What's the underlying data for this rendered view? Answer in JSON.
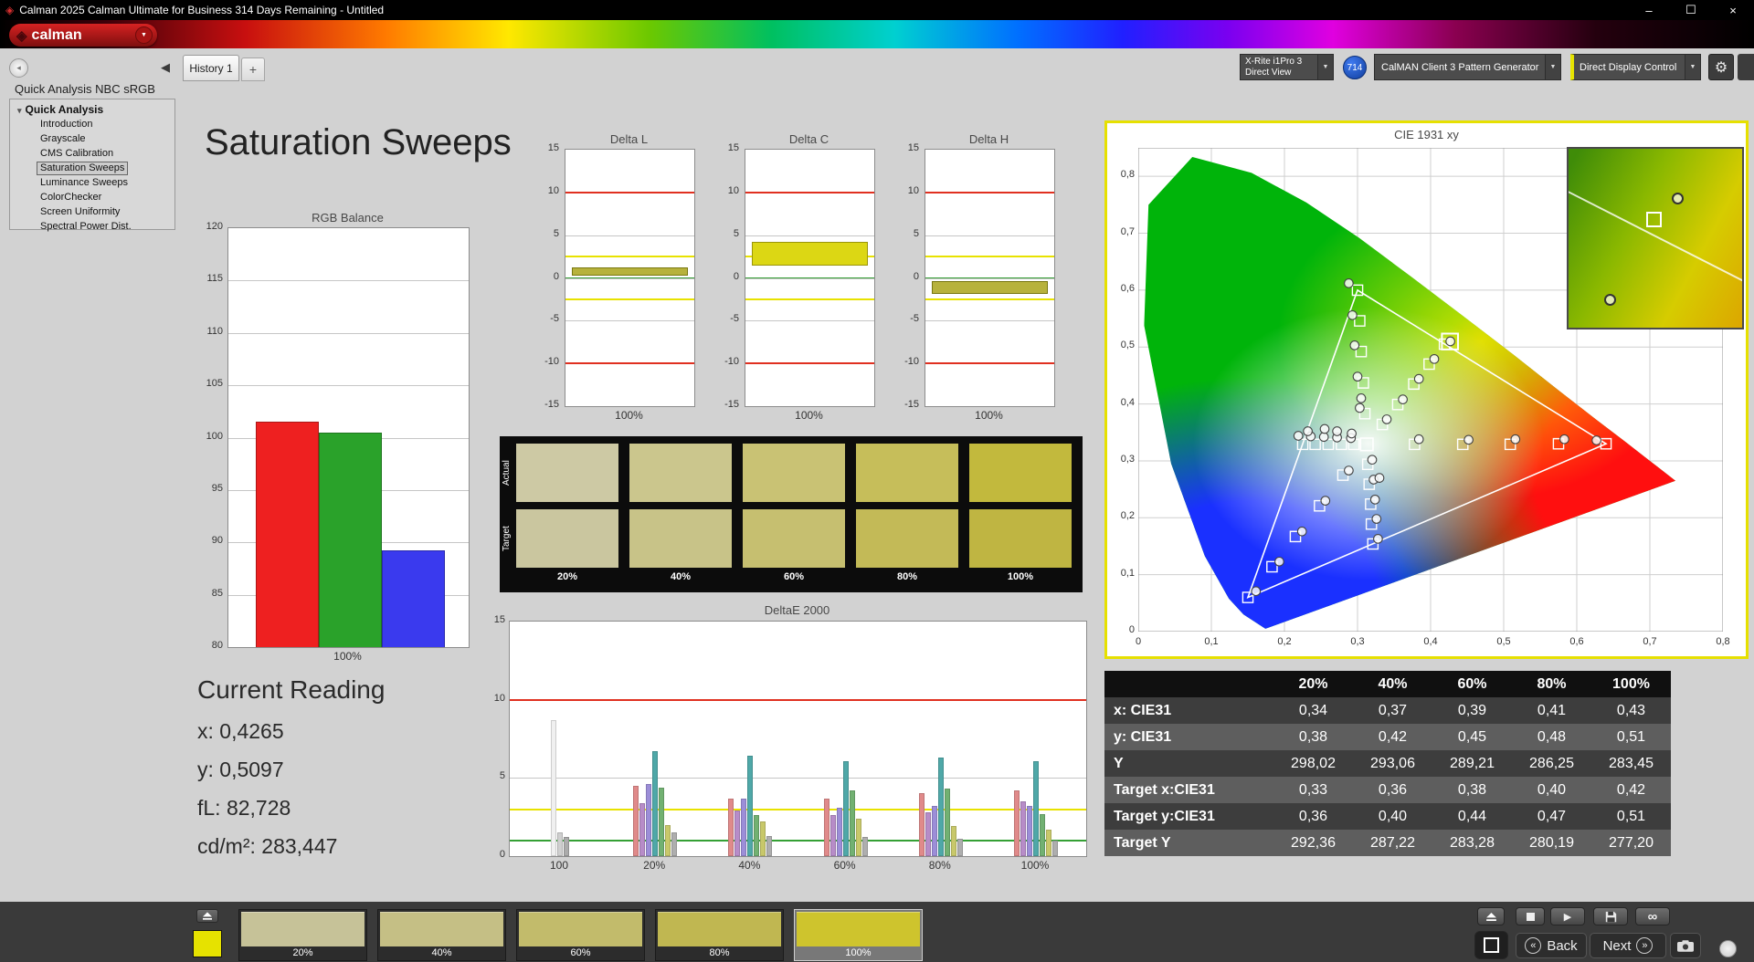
{
  "window": {
    "title": "Calman 2025 Calman Ultimate for Business 314 Days Remaining  - Untitled",
    "minimize_glyph": "–",
    "maximize_glyph": "☐",
    "close_glyph": "×"
  },
  "brand": {
    "logo_text": "calman"
  },
  "icons": {
    "app_diamond": "◈",
    "dropdown": "▼",
    "tree_expander": "▾",
    "collapse_left": "◀",
    "nav_circle": "◂",
    "gear": "⚙",
    "play": "▶",
    "infinity": "∞",
    "back_chevrons": "«",
    "next_chevrons": "»",
    "plus": "+"
  },
  "tabs": {
    "history_label": "History 1",
    "add_label": "+"
  },
  "toolbar": {
    "meter_line1": "X-Rite i1Pro 3",
    "meter_line2": "Direct View",
    "meter_count": "714",
    "pattern_generator": "CalMAN Client 3 Pattern Generator",
    "display_control": "Direct Display Control"
  },
  "sidebar": {
    "workflow_label": "Quick Analysis NBC sRGB",
    "root_label": "Quick Analysis",
    "items": [
      {
        "label": "Introduction",
        "selected": false
      },
      {
        "label": "Grayscale",
        "selected": false
      },
      {
        "label": "CMS Calibration",
        "selected": false
      },
      {
        "label": "Saturation Sweeps",
        "selected": true
      },
      {
        "label": "Luminance Sweeps",
        "selected": false
      },
      {
        "label": "ColorChecker",
        "selected": false
      },
      {
        "label": "Screen Uniformity",
        "selected": false
      },
      {
        "label": "Spectral Power Dist.",
        "selected": false
      }
    ]
  },
  "page": {
    "title": "Saturation Sweeps"
  },
  "current_reading": {
    "title": "Current Reading",
    "x": "x: 0,4265",
    "y": "y: 0,5097",
    "fl": "fL: 82,728",
    "cdm2": "cd/m²: 283,447"
  },
  "chart_data": [
    {
      "id": "rgb_balance",
      "type": "bar",
      "title": "RGB Balance",
      "categories": [
        "Red",
        "Green",
        "Blue"
      ],
      "values": [
        101.5,
        100.5,
        89.2
      ],
      "colors": [
        "#ee2020",
        "#2aa22a",
        "#3a3aee"
      ],
      "xlabel": "100%",
      "ylim": [
        80,
        120
      ],
      "yticks": [
        80,
        85,
        90,
        95,
        100,
        105,
        110,
        115,
        120
      ]
    },
    {
      "id": "delta_l",
      "type": "span-bar",
      "title": "Delta L",
      "ylim": [
        -15,
        15
      ],
      "yticks": [
        15,
        10,
        5,
        0,
        -5,
        -10,
        -15
      ],
      "xlabel": "100%",
      "span": {
        "from": 0.3,
        "to": 1.2
      },
      "bar_color": "#b7b23c",
      "bar_border": "#77770e",
      "ref_lines": [
        {
          "y": 10,
          "color": "#e03020"
        },
        {
          "y": -10,
          "color": "#e03020"
        },
        {
          "y": 2.5,
          "color": "#e8e200"
        },
        {
          "y": -2.5,
          "color": "#e8e200"
        },
        {
          "y": 0,
          "color": "#35a035"
        }
      ]
    },
    {
      "id": "delta_c",
      "type": "span-bar",
      "title": "Delta C",
      "ylim": [
        -15,
        15
      ],
      "yticks": [
        15,
        10,
        5,
        0,
        -5,
        -10,
        -15
      ],
      "xlabel": "100%",
      "span": {
        "from": 1.4,
        "to": 4.2
      },
      "bar_color": "#dcd714",
      "bar_border": "#99950a",
      "ref_lines": [
        {
          "y": 10,
          "color": "#e03020"
        },
        {
          "y": -10,
          "color": "#e03020"
        },
        {
          "y": 2.5,
          "color": "#e8e200"
        },
        {
          "y": -2.5,
          "color": "#e8e200"
        },
        {
          "y": 0,
          "color": "#35a035"
        }
      ]
    },
    {
      "id": "delta_h",
      "type": "span-bar",
      "title": "Delta H",
      "ylim": [
        -15,
        15
      ],
      "yticks": [
        15,
        10,
        5,
        0,
        -5,
        -10,
        -15
      ],
      "xlabel": "100%",
      "span": {
        "from": -1.9,
        "to": -0.4
      },
      "bar_color": "#b7b23c",
      "bar_border": "#77770e",
      "ref_lines": [
        {
          "y": 10,
          "color": "#e03020"
        },
        {
          "y": -10,
          "color": "#e03020"
        },
        {
          "y": 2.5,
          "color": "#e8e200"
        },
        {
          "y": -2.5,
          "color": "#e8e200"
        },
        {
          "y": 0,
          "color": "#35a035"
        }
      ]
    },
    {
      "id": "deltae_2000",
      "type": "grouped-bar",
      "title": "DeltaE 2000",
      "ylim": [
        0,
        15
      ],
      "yticks": [
        0,
        5,
        10,
        15
      ],
      "ref_lines": [
        {
          "y": 10,
          "color": "#e03020"
        },
        {
          "y": 3,
          "color": "#e8e200"
        },
        {
          "y": 1,
          "color": "#35a035"
        }
      ],
      "groups": [
        {
          "label": "100",
          "values": [
            8.7,
            1.5,
            1.2
          ],
          "colors": [
            "#f0f0f0",
            "#cfcfcf",
            "#ababab"
          ]
        },
        {
          "label": "20%",
          "values": [
            4.5,
            3.4,
            4.6,
            6.7,
            4.4,
            2.0,
            1.5
          ],
          "colors": [
            "#e08a8a",
            "#b78cc8",
            "#9c8ed8",
            "#4fa8a8",
            "#72b172",
            "#c8c86a",
            "#aeaeae"
          ]
        },
        {
          "label": "40%",
          "values": [
            3.7,
            2.9,
            3.7,
            6.4,
            2.6,
            2.2,
            1.3
          ],
          "colors": [
            "#e08a8a",
            "#b78cc8",
            "#9c8ed8",
            "#4fa8a8",
            "#72b172",
            "#c8c86a",
            "#aeaeae"
          ]
        },
        {
          "label": "60%",
          "values": [
            3.7,
            2.6,
            3.1,
            6.1,
            4.2,
            2.4,
            1.2
          ],
          "colors": [
            "#e08a8a",
            "#b78cc8",
            "#9c8ed8",
            "#4fa8a8",
            "#72b172",
            "#c8c86a",
            "#aeaeae"
          ]
        },
        {
          "label": "80%",
          "values": [
            4.0,
            2.8,
            3.2,
            6.3,
            4.3,
            1.9,
            1.1
          ],
          "colors": [
            "#e08a8a",
            "#b78cc8",
            "#9c8ed8",
            "#4fa8a8",
            "#72b172",
            "#c8c86a",
            "#aeaeae"
          ]
        },
        {
          "label": "100%",
          "values": [
            4.2,
            3.5,
            3.2,
            6.1,
            2.7,
            1.7,
            1.0
          ],
          "colors": [
            "#e08a8a",
            "#b78cc8",
            "#9c8ed8",
            "#4fa8a8",
            "#72b172",
            "#c8c86a",
            "#aeaeae"
          ]
        }
      ]
    },
    {
      "id": "cie_1931",
      "type": "chromaticity",
      "title": "CIE 1931 xy",
      "xlim": [
        0,
        0.8
      ],
      "ylim": [
        0,
        0.85
      ],
      "x_ticks": [
        "0",
        "0,1",
        "0,2",
        "0,3",
        "0,4",
        "0,5",
        "0,6",
        "0,7",
        "0,8"
      ],
      "y_ticks": [
        "0",
        "0,1",
        "0,2",
        "0,3",
        "0,4",
        "0,5",
        "0,6",
        "0,7",
        "0,8"
      ],
      "gamut_triangle": [
        [
          0.64,
          0.33
        ],
        [
          0.3,
          0.6
        ],
        [
          0.15,
          0.06
        ]
      ],
      "white_point": [
        0.3127,
        0.329
      ],
      "current_point": [
        0.4265,
        0.5097
      ],
      "target_points": [
        [
          0.378,
          0.329
        ],
        [
          0.444,
          0.329
        ],
        [
          0.509,
          0.329
        ],
        [
          0.575,
          0.33
        ],
        [
          0.64,
          0.33
        ],
        [
          0.31,
          0.383
        ],
        [
          0.308,
          0.437
        ],
        [
          0.305,
          0.492
        ],
        [
          0.303,
          0.546
        ],
        [
          0.3,
          0.6
        ],
        [
          0.28,
          0.275
        ],
        [
          0.248,
          0.221
        ],
        [
          0.215,
          0.167
        ],
        [
          0.183,
          0.114
        ],
        [
          0.15,
          0.06
        ],
        [
          0.295,
          0.329
        ],
        [
          0.278,
          0.329
        ],
        [
          0.26,
          0.329
        ],
        [
          0.242,
          0.329
        ],
        [
          0.225,
          0.329
        ],
        [
          0.314,
          0.294
        ],
        [
          0.316,
          0.259
        ],
        [
          0.318,
          0.224
        ],
        [
          0.319,
          0.189
        ],
        [
          0.321,
          0.154
        ],
        [
          0.334,
          0.364
        ],
        [
          0.355,
          0.399
        ],
        [
          0.377,
          0.435
        ],
        [
          0.398,
          0.47
        ],
        [
          0.419,
          0.505
        ]
      ],
      "measured_points": [
        [
          0.384,
          0.338
        ],
        [
          0.452,
          0.337
        ],
        [
          0.516,
          0.338
        ],
        [
          0.583,
          0.338
        ],
        [
          0.627,
          0.336
        ],
        [
          0.303,
          0.393
        ],
        [
          0.3,
          0.448
        ],
        [
          0.296,
          0.503
        ],
        [
          0.293,
          0.556
        ],
        [
          0.288,
          0.612
        ],
        [
          0.288,
          0.283
        ],
        [
          0.256,
          0.23
        ],
        [
          0.224,
          0.176
        ],
        [
          0.193,
          0.123
        ],
        [
          0.161,
          0.071
        ],
        [
          0.291,
          0.34
        ],
        [
          0.272,
          0.341
        ],
        [
          0.254,
          0.342
        ],
        [
          0.236,
          0.343
        ],
        [
          0.219,
          0.344
        ],
        [
          0.32,
          0.302
        ],
        [
          0.322,
          0.267
        ],
        [
          0.324,
          0.232
        ],
        [
          0.326,
          0.198
        ],
        [
          0.328,
          0.163
        ],
        [
          0.34,
          0.373
        ],
        [
          0.362,
          0.408
        ],
        [
          0.384,
          0.444
        ],
        [
          0.405,
          0.479
        ],
        [
          0.427,
          0.51
        ],
        [
          0.232,
          0.352
        ],
        [
          0.255,
          0.356
        ],
        [
          0.272,
          0.352
        ],
        [
          0.292,
          0.348
        ],
        [
          0.305,
          0.41
        ],
        [
          0.33,
          0.27
        ]
      ],
      "inset": {
        "square": [
          0.5,
          0.4
        ],
        "circles": [
          [
            0.64,
            0.28
          ],
          [
            0.24,
            0.86
          ]
        ]
      }
    }
  ],
  "swatch_grid": {
    "row_labels": [
      "Actual",
      "Target"
    ],
    "col_labels": [
      "20%",
      "40%",
      "60%",
      "80%",
      "100%"
    ],
    "actual_colors": [
      "#cdc9a4",
      "#cbc68d",
      "#c9c274",
      "#c6be5a",
      "#c2b93d"
    ],
    "target_colors": [
      "#cac69f",
      "#c8c388",
      "#c6bf70",
      "#c3ba57",
      "#bfb542"
    ]
  },
  "results_table": {
    "col_headers": [
      "20%",
      "40%",
      "60%",
      "80%",
      "100%"
    ],
    "rows": [
      {
        "label": "x: CIE31",
        "values": [
          "0,34",
          "0,37",
          "0,39",
          "0,41",
          "0,43"
        ]
      },
      {
        "label": "y: CIE31",
        "values": [
          "0,38",
          "0,42",
          "0,45",
          "0,48",
          "0,51"
        ]
      },
      {
        "label": "Y",
        "values": [
          "298,02",
          "293,06",
          "289,21",
          "286,25",
          "283,45"
        ]
      },
      {
        "label": "Target x:CIE31",
        "values": [
          "0,33",
          "0,36",
          "0,38",
          "0,40",
          "0,42"
        ]
      },
      {
        "label": "Target y:CIE31",
        "values": [
          "0,36",
          "0,40",
          "0,44",
          "0,47",
          "0,51"
        ]
      },
      {
        "label": "Target Y",
        "values": [
          "292,36",
          "287,22",
          "283,28",
          "280,19",
          "277,20"
        ]
      }
    ]
  },
  "bottombar": {
    "active_color": "#e6e200",
    "patches": [
      {
        "label": "20%",
        "color": "#c6c298",
        "selected": false
      },
      {
        "label": "40%",
        "color": "#c5bf85",
        "selected": false
      },
      {
        "label": "60%",
        "color": "#c2bb6b",
        "selected": false
      },
      {
        "label": "80%",
        "color": "#c0b751",
        "selected": false
      },
      {
        "label": "100%",
        "color": "#cec42d",
        "selected": true
      }
    ],
    "back_label": "Back",
    "next_label": "Next"
  }
}
